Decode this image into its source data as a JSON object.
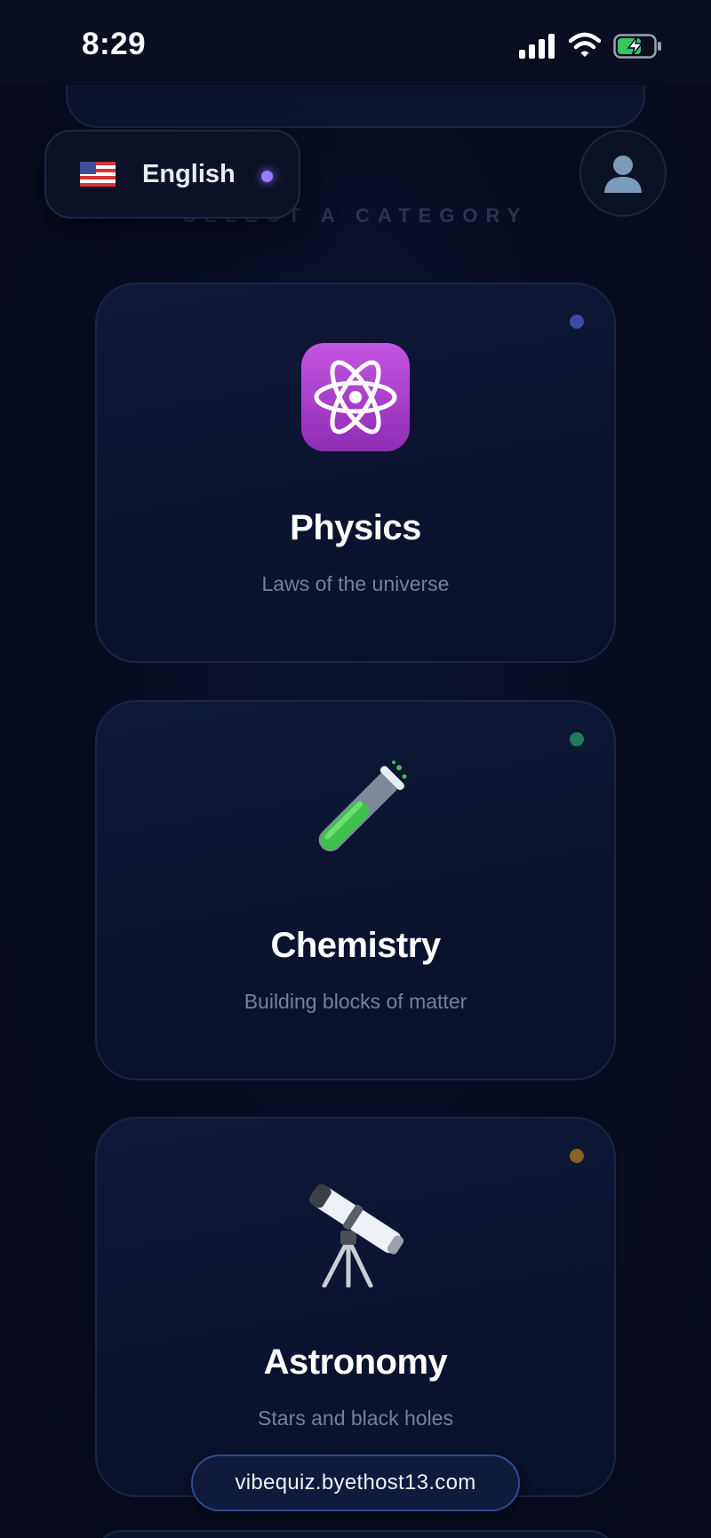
{
  "status_bar": {
    "time": "8:29",
    "icons": [
      "signal-icon",
      "wifi-icon",
      "battery-charging-icon"
    ]
  },
  "language_selector": {
    "label": "English",
    "flag": "us-flag-icon",
    "indicator_color": "#9b7bff"
  },
  "profile": {
    "icon": "user-icon"
  },
  "section_heading": "SELECT A CATEGORY",
  "categories": [
    {
      "title": "Physics",
      "subtitle": "Laws of the universe",
      "icon": "atom-icon",
      "dot_color": "#3d4aa6"
    },
    {
      "title": "Chemistry",
      "subtitle": "Building blocks of matter",
      "icon": "test-tube-icon",
      "dot_color": "#1f7a5c"
    },
    {
      "title": "Astronomy",
      "subtitle": "Stars and black holes",
      "icon": "telescope-icon",
      "dot_color": "#8a6420"
    }
  ],
  "url_bar": {
    "url": "vibequiz.byethost13.com"
  }
}
